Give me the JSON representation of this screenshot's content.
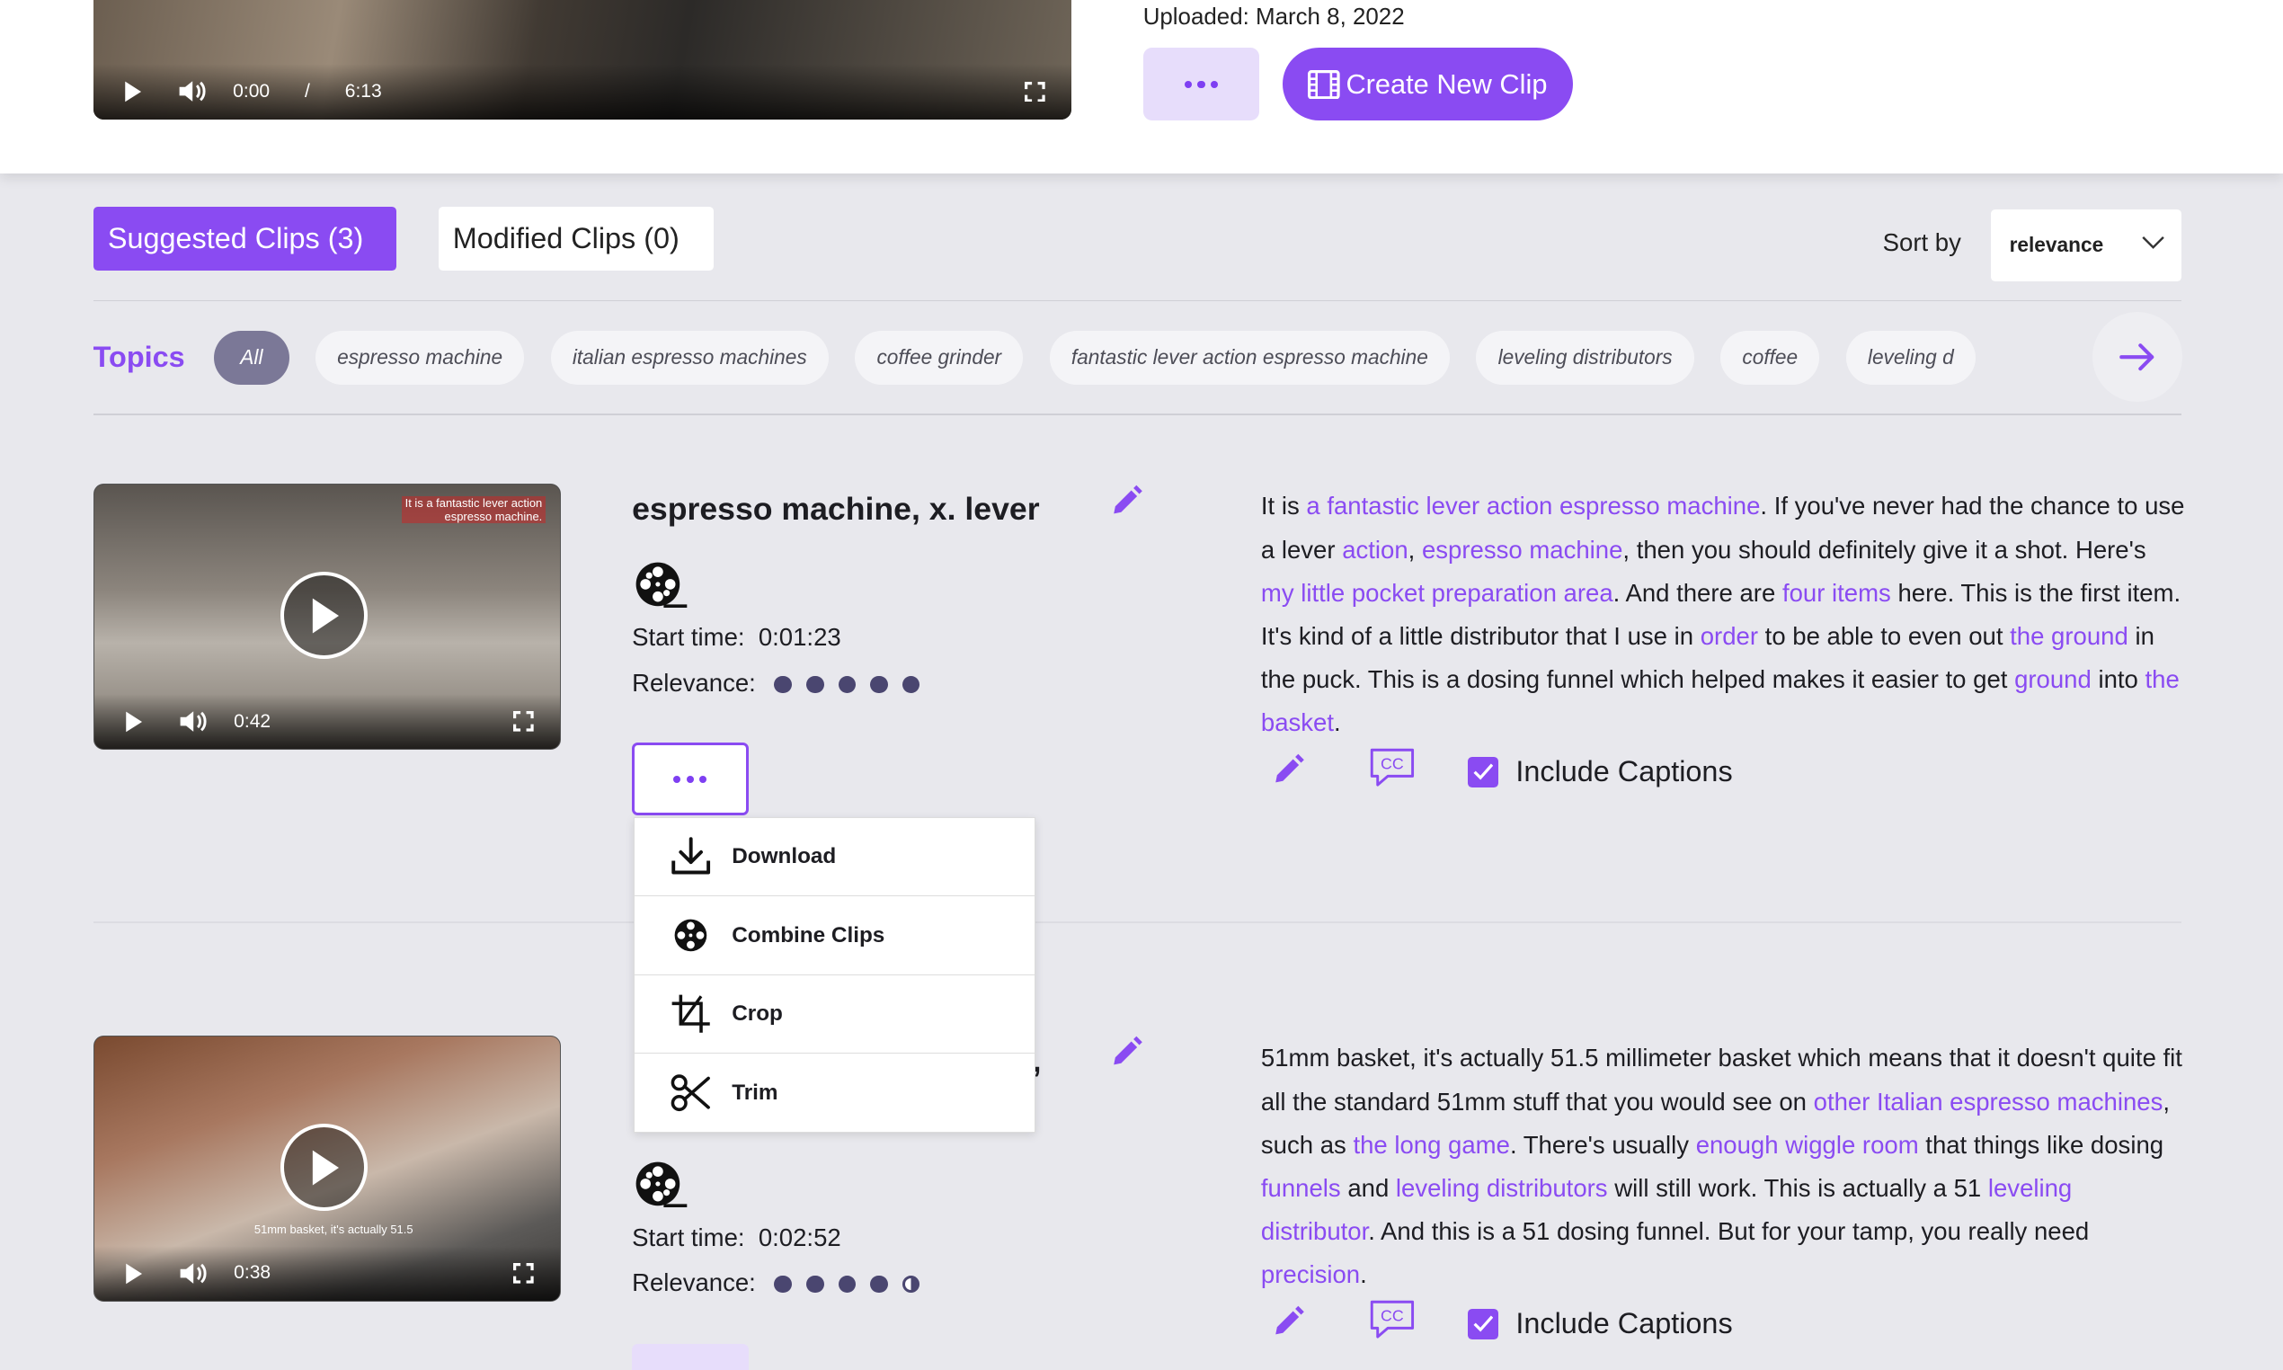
{
  "top": {
    "player": {
      "current_time": "0:00",
      "separator": "/",
      "duration": "6:13"
    },
    "uploaded": "Uploaded: March 8, 2022",
    "create_clip_label": "Create New Clip"
  },
  "tabs": [
    {
      "label": "Suggested Clips (3)",
      "active": true
    },
    {
      "label": "Modified Clips (0)",
      "active": false
    }
  ],
  "sort": {
    "label": "Sort by",
    "value": "relevance"
  },
  "topics": {
    "label": "Topics",
    "chips": [
      "All",
      "espresso machine",
      "italian espresso machines",
      "coffee grinder",
      "fantastic lever action espresso machine",
      "leveling distributors",
      "coffee",
      "leveling d"
    ]
  },
  "clips": [
    {
      "title": "espresso machine, x. lever",
      "video_time": "0:42",
      "caption_overlay": [
        "It is a fantastic lever action",
        "espresso machine."
      ],
      "start_time_label": "Start time:",
      "start_time": "0:01:23",
      "relevance_label": "Relevance:",
      "relevance": 5,
      "include_captions": "Include Captions",
      "transcript": [
        {
          "t": "It is ",
          "k": false
        },
        {
          "t": "a fantastic lever action espresso machine",
          "k": true
        },
        {
          "t": ". If you've never had the chance to use a lever ",
          "k": false
        },
        {
          "t": "action",
          "k": true
        },
        {
          "t": ", ",
          "k": false
        },
        {
          "t": "espresso machine",
          "k": true
        },
        {
          "t": ", then you should definitely give it a shot. Here's ",
          "k": false
        },
        {
          "t": "my little pocket preparation area",
          "k": true
        },
        {
          "t": ". And there are ",
          "k": false
        },
        {
          "t": "four items",
          "k": true
        },
        {
          "t": " here. This is the first item. It's kind of a little distributor that I use in ",
          "k": false
        },
        {
          "t": "order",
          "k": true
        },
        {
          "t": " to be able to even out ",
          "k": false
        },
        {
          "t": "the ground",
          "k": true
        },
        {
          "t": " in the puck. This is a dosing funnel which helped makes it easier to get ",
          "k": false
        },
        {
          "t": "ground",
          "k": true
        },
        {
          "t": " into ",
          "k": false
        },
        {
          "t": "the basket",
          "k": true
        },
        {
          "t": ".",
          "k": false
        }
      ]
    },
    {
      "title": "",
      "title_visible_fragment": ",",
      "video_time": "0:38",
      "caption_overlay": [
        "51mm basket, it's actually 51.5"
      ],
      "start_time_label": "Start time:",
      "start_time": "0:02:52",
      "relevance_label": "Relevance:",
      "relevance": 4.5,
      "include_captions": "Include Captions",
      "transcript": [
        {
          "t": "51mm basket, it's actually 51.5 millimeter basket which means that it doesn't quite fit all the standard 51mm stuff that you would see on ",
          "k": false
        },
        {
          "t": "other Italian espresso machines",
          "k": true
        },
        {
          "t": ", such as ",
          "k": false
        },
        {
          "t": "the long game",
          "k": true
        },
        {
          "t": ". There's usually ",
          "k": false
        },
        {
          "t": "enough wiggle room",
          "k": true
        },
        {
          "t": " that things like dosing ",
          "k": false
        },
        {
          "t": "funnels",
          "k": true
        },
        {
          "t": " and ",
          "k": false
        },
        {
          "t": "leveling distributors",
          "k": true
        },
        {
          "t": " will still work. This is actually a 51 ",
          "k": false
        },
        {
          "t": "leveling distributor",
          "k": true
        },
        {
          "t": ". And this is a 51 dosing funnel. But for your tamp, you really need ",
          "k": false
        },
        {
          "t": "precision",
          "k": true
        },
        {
          "t": ".",
          "k": false
        }
      ]
    }
  ],
  "menu": {
    "items": [
      {
        "label": "Download",
        "icon": "download-icon"
      },
      {
        "label": "Combine Clips",
        "icon": "film-reel-icon"
      },
      {
        "label": "Crop",
        "icon": "crop-icon"
      },
      {
        "label": "Trim",
        "icon": "scissors-icon"
      }
    ]
  },
  "colors": {
    "accent": "#8a4bf2",
    "accent_light": "#e7ddfb",
    "chip_active": "#7b7897",
    "background": "#e8e8ed",
    "relevance_dot": "#4a4670"
  }
}
